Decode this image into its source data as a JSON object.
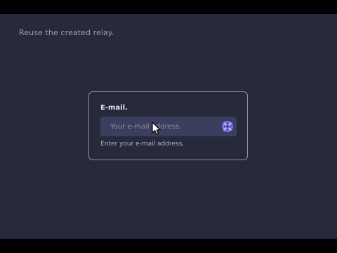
{
  "instruction": "Reuse the created relay.",
  "form": {
    "label": "E-mail.",
    "placeholder": "Your e-mail address.",
    "value": "",
    "helper": "Enter your e-mail address.",
    "relay_icon": "relay-mask-icon",
    "accent": "#7b6df0"
  }
}
